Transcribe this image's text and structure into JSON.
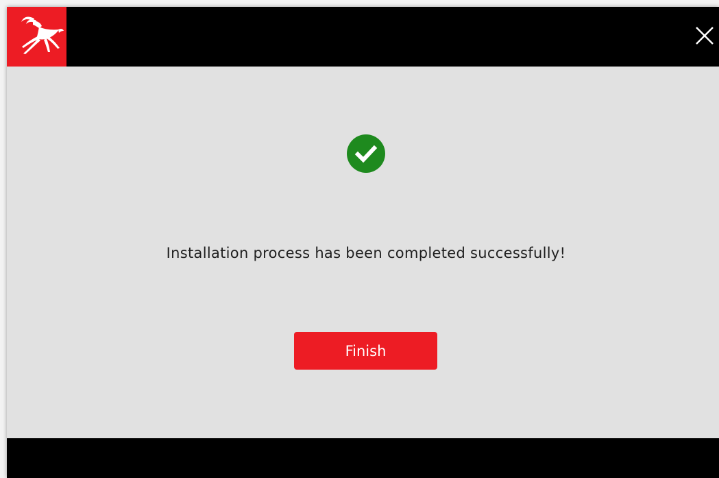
{
  "window": {
    "logo_icon": "gazelle-logo-icon",
    "close_icon": "close-icon"
  },
  "main": {
    "status_icon": "success-check-icon",
    "message": "Installation process has been completed successfully!",
    "finish_label": "Finish"
  },
  "colors": {
    "brand_red": "#ed1c24",
    "success_green": "#1e8a1e",
    "titlebar": "#000000",
    "content_bg": "#e1e1e1"
  }
}
